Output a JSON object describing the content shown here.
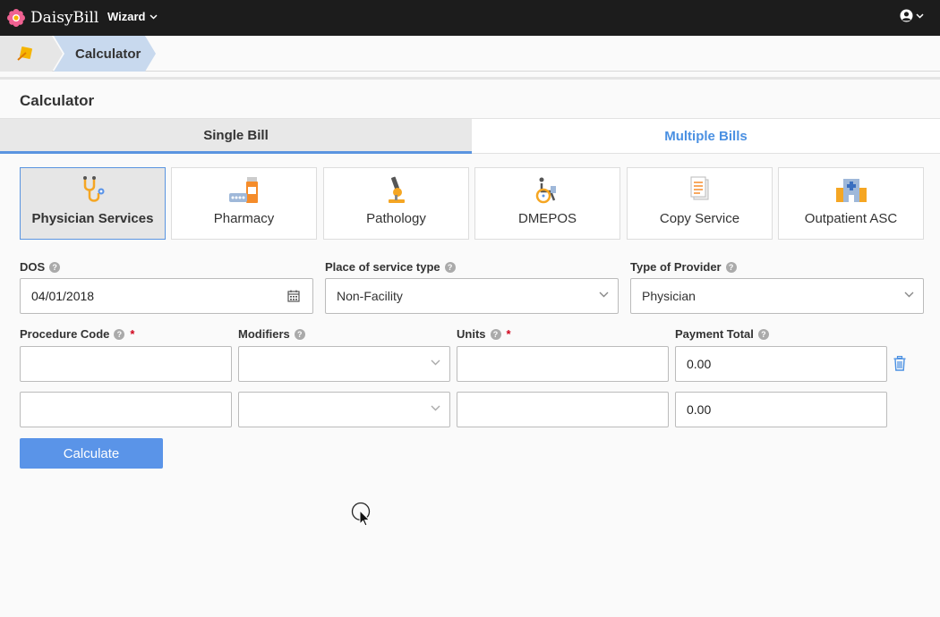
{
  "navbar": {
    "brand": "DaisyBill",
    "menu_label": "Wizard"
  },
  "breadcrumb": {
    "current": "Calculator"
  },
  "page": {
    "title": "Calculator"
  },
  "tabs": [
    {
      "label": "Single Bill",
      "active": true
    },
    {
      "label": "Multiple Bills",
      "active": false
    }
  ],
  "categories": [
    {
      "label": "Physician Services",
      "icon": "stethoscope-icon",
      "active": true
    },
    {
      "label": "Pharmacy",
      "icon": "pills-icon",
      "active": false
    },
    {
      "label": "Pathology",
      "icon": "microscope-icon",
      "active": false
    },
    {
      "label": "DMEPOS",
      "icon": "wheelchair-icon",
      "active": false
    },
    {
      "label": "Copy Service",
      "icon": "document-copy-icon",
      "active": false
    },
    {
      "label": "Outpatient ASC",
      "icon": "hospital-icon",
      "active": false
    }
  ],
  "form": {
    "dos": {
      "label": "DOS",
      "value": "04/01/2018"
    },
    "place_of_service": {
      "label": "Place of service type",
      "value": "Non-Facility"
    },
    "provider_type": {
      "label": "Type of Provider",
      "value": "Physician"
    },
    "columns": {
      "procedure_code": "Procedure Code",
      "modifiers": "Modifiers",
      "units": "Units",
      "payment_total": "Payment Total"
    },
    "required_marker": "*",
    "rows": [
      {
        "procedure_code": "",
        "modifiers": "",
        "units": "",
        "payment_total": "0.00"
      },
      {
        "procedure_code": "",
        "modifiers": "",
        "units": "",
        "payment_total": "0.00"
      }
    ],
    "calculate_label": "Calculate"
  },
  "colors": {
    "accent": "#5a94e8",
    "tab_link": "#4a90e2",
    "navbar": "#1c1c1c",
    "required": "#d0021b"
  }
}
